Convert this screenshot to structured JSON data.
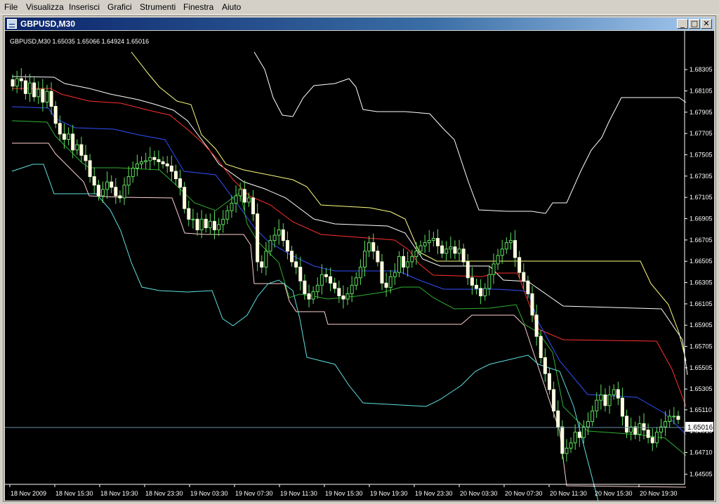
{
  "menu": [
    "File",
    "Visualizza",
    "Inserisci",
    "Grafici",
    "Strumenti",
    "Finestra",
    "Aiuto"
  ],
  "window": {
    "title": "GBPUSD,M30"
  },
  "chart_data": {
    "type": "candlestick",
    "title": "GBPUSD,M30  1.65035 1.65066 1.64924 1.65016",
    "symbol": "GBPUSD",
    "timeframe": "M30",
    "ohlc_header": {
      "open": 1.65035,
      "high": 1.65066,
      "low": 1.64924,
      "close": 1.65016
    },
    "current_price": 1.65016,
    "current_price_label": "1.65016",
    "y_tick_labels": [
      "1.68305",
      "1.68105",
      "1.67905",
      "1.67705",
      "1.67505",
      "1.67305",
      "1.67105",
      "1.66905",
      "1.66705",
      "1.66505",
      "1.66305",
      "1.66105",
      "1.65905",
      "1.65705",
      "1.65505",
      "1.65305",
      "1.65110",
      "1.64910",
      "1.64710",
      "1.64505"
    ],
    "x_tick_labels": [
      "18 Nov 2009",
      "18 Nov 15:30",
      "18 Nov 19:30",
      "18 Nov 23:30",
      "19 Nov 03:30",
      "19 Nov 07:30",
      "19 Nov 11:30",
      "19 Nov 15:30",
      "19 Nov 19:30",
      "19 Nov 23:30",
      "20 Nov 03:30",
      "20 Nov 07:30",
      "20 Nov 11:30",
      "20 Nov 15:30",
      "20 Nov 19:30"
    ],
    "ylim": [
      1.6441,
      1.6855
    ],
    "closes": [
      1.6815,
      1.6822,
      1.682,
      1.6808,
      1.6818,
      1.6805,
      1.6812,
      1.68,
      1.681,
      1.6796,
      1.678,
      1.677,
      1.6765,
      1.677,
      1.6755,
      1.676,
      1.675,
      1.6745,
      1.673,
      1.6722,
      1.6712,
      1.6718,
      1.6725,
      1.672,
      1.6712,
      1.671,
      1.6722,
      1.673,
      1.6738,
      1.6742,
      1.6744,
      1.6745,
      1.6748,
      1.6746,
      1.6744,
      1.6742,
      1.674,
      1.6735,
      1.6728,
      1.672,
      1.67,
      1.669,
      1.669,
      1.668,
      1.669,
      1.6682,
      1.6688,
      1.668,
      1.6685,
      1.669,
      1.6698,
      1.6705,
      1.6712,
      1.6718,
      1.6706,
      1.671,
      1.6695,
      1.665,
      1.6645,
      1.666,
      1.667,
      1.6675,
      1.668,
      1.667,
      1.666,
      1.665,
      1.6645,
      1.6632,
      1.662,
      1.6615,
      1.6622,
      1.6628,
      1.6638,
      1.6636,
      1.663,
      1.6625,
      1.6618,
      1.6615,
      1.662,
      1.6628,
      1.6635,
      1.6645,
      1.666,
      1.6668,
      1.666,
      1.665,
      1.663,
      1.6626,
      1.6636,
      1.664,
      1.6655,
      1.6645,
      1.665,
      1.6655,
      1.666,
      1.6665,
      1.6668,
      1.667,
      1.6672,
      1.6665,
      1.6658,
      1.6662,
      1.6664,
      1.6658,
      1.6662,
      1.665,
      1.6635,
      1.6628,
      1.6625,
      1.6618,
      1.6625,
      1.6638,
      1.6648,
      1.6656,
      1.6662,
      1.6668,
      1.667,
      1.6654,
      1.664,
      1.6632,
      1.662,
      1.66,
      1.658,
      1.656,
      1.6545,
      1.653,
      1.651,
      1.6495,
      1.647,
      1.6475,
      1.648,
      1.649,
      1.6485,
      1.6495,
      1.65,
      1.651,
      1.652,
      1.6525,
      1.6515,
      1.6525,
      1.653,
      1.6522,
      1.6505,
      1.649,
      1.6495,
      1.6488,
      1.6498,
      1.6492,
      1.6485,
      1.648,
      1.649,
      1.6495,
      1.65,
      1.6505,
      1.6505,
      1.6502
    ],
    "indicator_lines": [
      {
        "color": "#ffff80",
        "points": [
          [
            180,
            30
          ],
          [
            205,
            62
          ],
          [
            220,
            80
          ],
          [
            245,
            100
          ],
          [
            265,
            105
          ],
          [
            280,
            148
          ],
          [
            300,
            168
          ],
          [
            315,
            190
          ],
          [
            340,
            198
          ],
          [
            410,
            212
          ],
          [
            430,
            222
          ],
          [
            450,
            248
          ],
          [
            520,
            252
          ],
          [
            550,
            258
          ],
          [
            570,
            268
          ],
          [
            590,
            315
          ],
          [
            615,
            328
          ],
          [
            700,
            328
          ],
          [
            905,
            328
          ],
          [
            920,
            360
          ],
          [
            945,
            390
          ],
          [
            960,
            430
          ],
          [
            970,
            470
          ]
        ]
      },
      {
        "color": "#ffffff",
        "points": [
          [
            10,
            65
          ],
          [
            70,
            66
          ],
          [
            85,
            75
          ],
          [
            120,
            82
          ],
          [
            150,
            90
          ],
          [
            190,
            98
          ],
          [
            215,
            105
          ],
          [
            240,
            113
          ],
          [
            260,
            128
          ],
          [
            275,
            148
          ],
          [
            290,
            168
          ],
          [
            305,
            190
          ],
          [
            340,
            215
          ],
          [
            370,
            225
          ],
          [
            400,
            238
          ],
          [
            440,
            268
          ],
          [
            470,
            275
          ],
          [
            545,
            278
          ],
          [
            570,
            288
          ],
          [
            595,
            325
          ],
          [
            620,
            335
          ],
          [
            690,
            335
          ],
          [
            710,
            355
          ],
          [
            745,
            357
          ],
          [
            795,
            392
          ],
          [
            935,
            396
          ],
          [
            965,
            440
          ],
          [
            972,
            490
          ]
        ]
      },
      {
        "color": "#ff3030",
        "points": [
          [
            10,
            82
          ],
          [
            65,
            82
          ],
          [
            80,
            90
          ],
          [
            120,
            100
          ],
          [
            165,
            103
          ],
          [
            200,
            112
          ],
          [
            235,
            120
          ],
          [
            262,
            142
          ],
          [
            282,
            160
          ],
          [
            300,
            180
          ],
          [
            325,
            212
          ],
          [
            348,
            235
          ],
          [
            378,
            248
          ],
          [
            410,
            272
          ],
          [
            450,
            290
          ],
          [
            555,
            298
          ],
          [
            575,
            312
          ],
          [
            590,
            332
          ],
          [
            610,
            348
          ],
          [
            680,
            350
          ],
          [
            700,
            345
          ],
          [
            730,
            345
          ],
          [
            760,
            425
          ],
          [
            795,
            440
          ],
          [
            928,
            442
          ],
          [
            950,
            482
          ],
          [
            970,
            535
          ]
        ]
      },
      {
        "color": "#3050ff",
        "points": [
          [
            10,
            108
          ],
          [
            62,
            110
          ],
          [
            72,
            125
          ],
          [
            100,
            138
          ],
          [
            155,
            140
          ],
          [
            190,
            148
          ],
          [
            228,
            155
          ],
          [
            255,
            200
          ],
          [
            300,
            205
          ],
          [
            335,
            252
          ],
          [
            355,
            280
          ],
          [
            375,
            300
          ],
          [
            405,
            318
          ],
          [
            440,
            335
          ],
          [
            470,
            342
          ],
          [
            560,
            342
          ],
          [
            590,
            355
          ],
          [
            625,
            368
          ],
          [
            700,
            368
          ],
          [
            735,
            370
          ],
          [
            745,
            372
          ],
          [
            760,
            415
          ],
          [
            790,
            470
          ],
          [
            830,
            518
          ],
          [
            900,
            522
          ],
          [
            940,
            545
          ],
          [
            970,
            575
          ]
        ]
      },
      {
        "color": "#30b030",
        "points": [
          [
            10,
            128
          ],
          [
            60,
            130
          ],
          [
            72,
            150
          ],
          [
            110,
            188
          ],
          [
            120,
            195
          ],
          [
            160,
            195
          ],
          [
            220,
            198
          ],
          [
            242,
            218
          ],
          [
            270,
            245
          ],
          [
            300,
            256
          ],
          [
            335,
            230
          ],
          [
            345,
            275
          ],
          [
            360,
            300
          ],
          [
            390,
            330
          ],
          [
            405,
            380
          ],
          [
            420,
            375
          ],
          [
            440,
            378
          ],
          [
            460,
            382
          ],
          [
            500,
            378
          ],
          [
            540,
            372
          ],
          [
            565,
            365
          ],
          [
            590,
            365
          ],
          [
            610,
            380
          ],
          [
            640,
            396
          ],
          [
            690,
            395
          ],
          [
            728,
            390
          ],
          [
            740,
            418
          ],
          [
            760,
            430
          ],
          [
            780,
            458
          ],
          [
            795,
            535
          ],
          [
            830,
            570
          ],
          [
            900,
            575
          ],
          [
            940,
            580
          ],
          [
            970,
            605
          ]
        ]
      },
      {
        "color": "#ffd0d0",
        "points": [
          [
            10,
            160
          ],
          [
            62,
            160
          ],
          [
            72,
            175
          ],
          [
            112,
            215
          ],
          [
            120,
            235
          ],
          [
            165,
            237
          ],
          [
            238,
            238
          ],
          [
            248,
            265
          ],
          [
            256,
            288
          ],
          [
            285,
            290
          ],
          [
            340,
            290
          ],
          [
            350,
            305
          ],
          [
            355,
            360
          ],
          [
            398,
            360
          ],
          [
            405,
            385
          ],
          [
            415,
            400
          ],
          [
            455,
            400
          ],
          [
            460,
            418
          ],
          [
            650,
            418
          ],
          [
            665,
            405
          ],
          [
            725,
            405
          ],
          [
            740,
            420
          ],
          [
            790,
            570
          ],
          [
            800,
            648
          ],
          [
            970,
            650
          ]
        ]
      },
      {
        "color": "#60e0e0",
        "points": [
          [
            10,
            200
          ],
          [
            40,
            190
          ],
          [
            55,
            190
          ],
          [
            70,
            232
          ],
          [
            130,
            232
          ],
          [
            150,
            255
          ],
          [
            165,
            285
          ],
          [
            180,
            330
          ],
          [
            195,
            365
          ],
          [
            220,
            370
          ],
          [
            260,
            372
          ],
          [
            295,
            370
          ],
          [
            310,
            410
          ],
          [
            325,
            420
          ],
          [
            345,
            405
          ],
          [
            360,
            378
          ],
          [
            375,
            360
          ],
          [
            390,
            355
          ],
          [
            410,
            370
          ],
          [
            420,
            410
          ],
          [
            430,
            465
          ],
          [
            470,
            475
          ],
          [
            490,
            505
          ],
          [
            510,
            530
          ],
          [
            600,
            535
          ],
          [
            620,
            525
          ],
          [
            650,
            505
          ],
          [
            670,
            485
          ],
          [
            690,
            475
          ],
          [
            745,
            462
          ],
          [
            760,
            475
          ],
          [
            790,
            485
          ],
          [
            810,
            535
          ],
          [
            845,
            670
          ]
        ]
      },
      {
        "color": "#ffffff",
        "points": [
          [
            355,
            30
          ],
          [
            370,
            55
          ],
          [
            382,
            95
          ],
          [
            395,
            120
          ],
          [
            410,
            122
          ],
          [
            425,
            95
          ],
          [
            440,
            78
          ],
          [
            470,
            75
          ],
          [
            490,
            68
          ],
          [
            500,
            80
          ],
          [
            510,
            112
          ],
          [
            530,
            115
          ],
          [
            570,
            115
          ],
          [
            605,
            118
          ],
          [
            625,
            140
          ],
          [
            640,
            155
          ],
          [
            660,
            215
          ],
          [
            675,
            255
          ],
          [
            715,
            257
          ],
          [
            750,
            257
          ],
          [
            770,
            260
          ],
          [
            780,
            245
          ],
          [
            800,
            245
          ],
          [
            820,
            200
          ],
          [
            835,
            170
          ],
          [
            850,
            152
          ],
          [
            860,
            130
          ],
          [
            878,
            95
          ],
          [
            960,
            95
          ],
          [
            970,
            102
          ]
        ]
      }
    ]
  }
}
